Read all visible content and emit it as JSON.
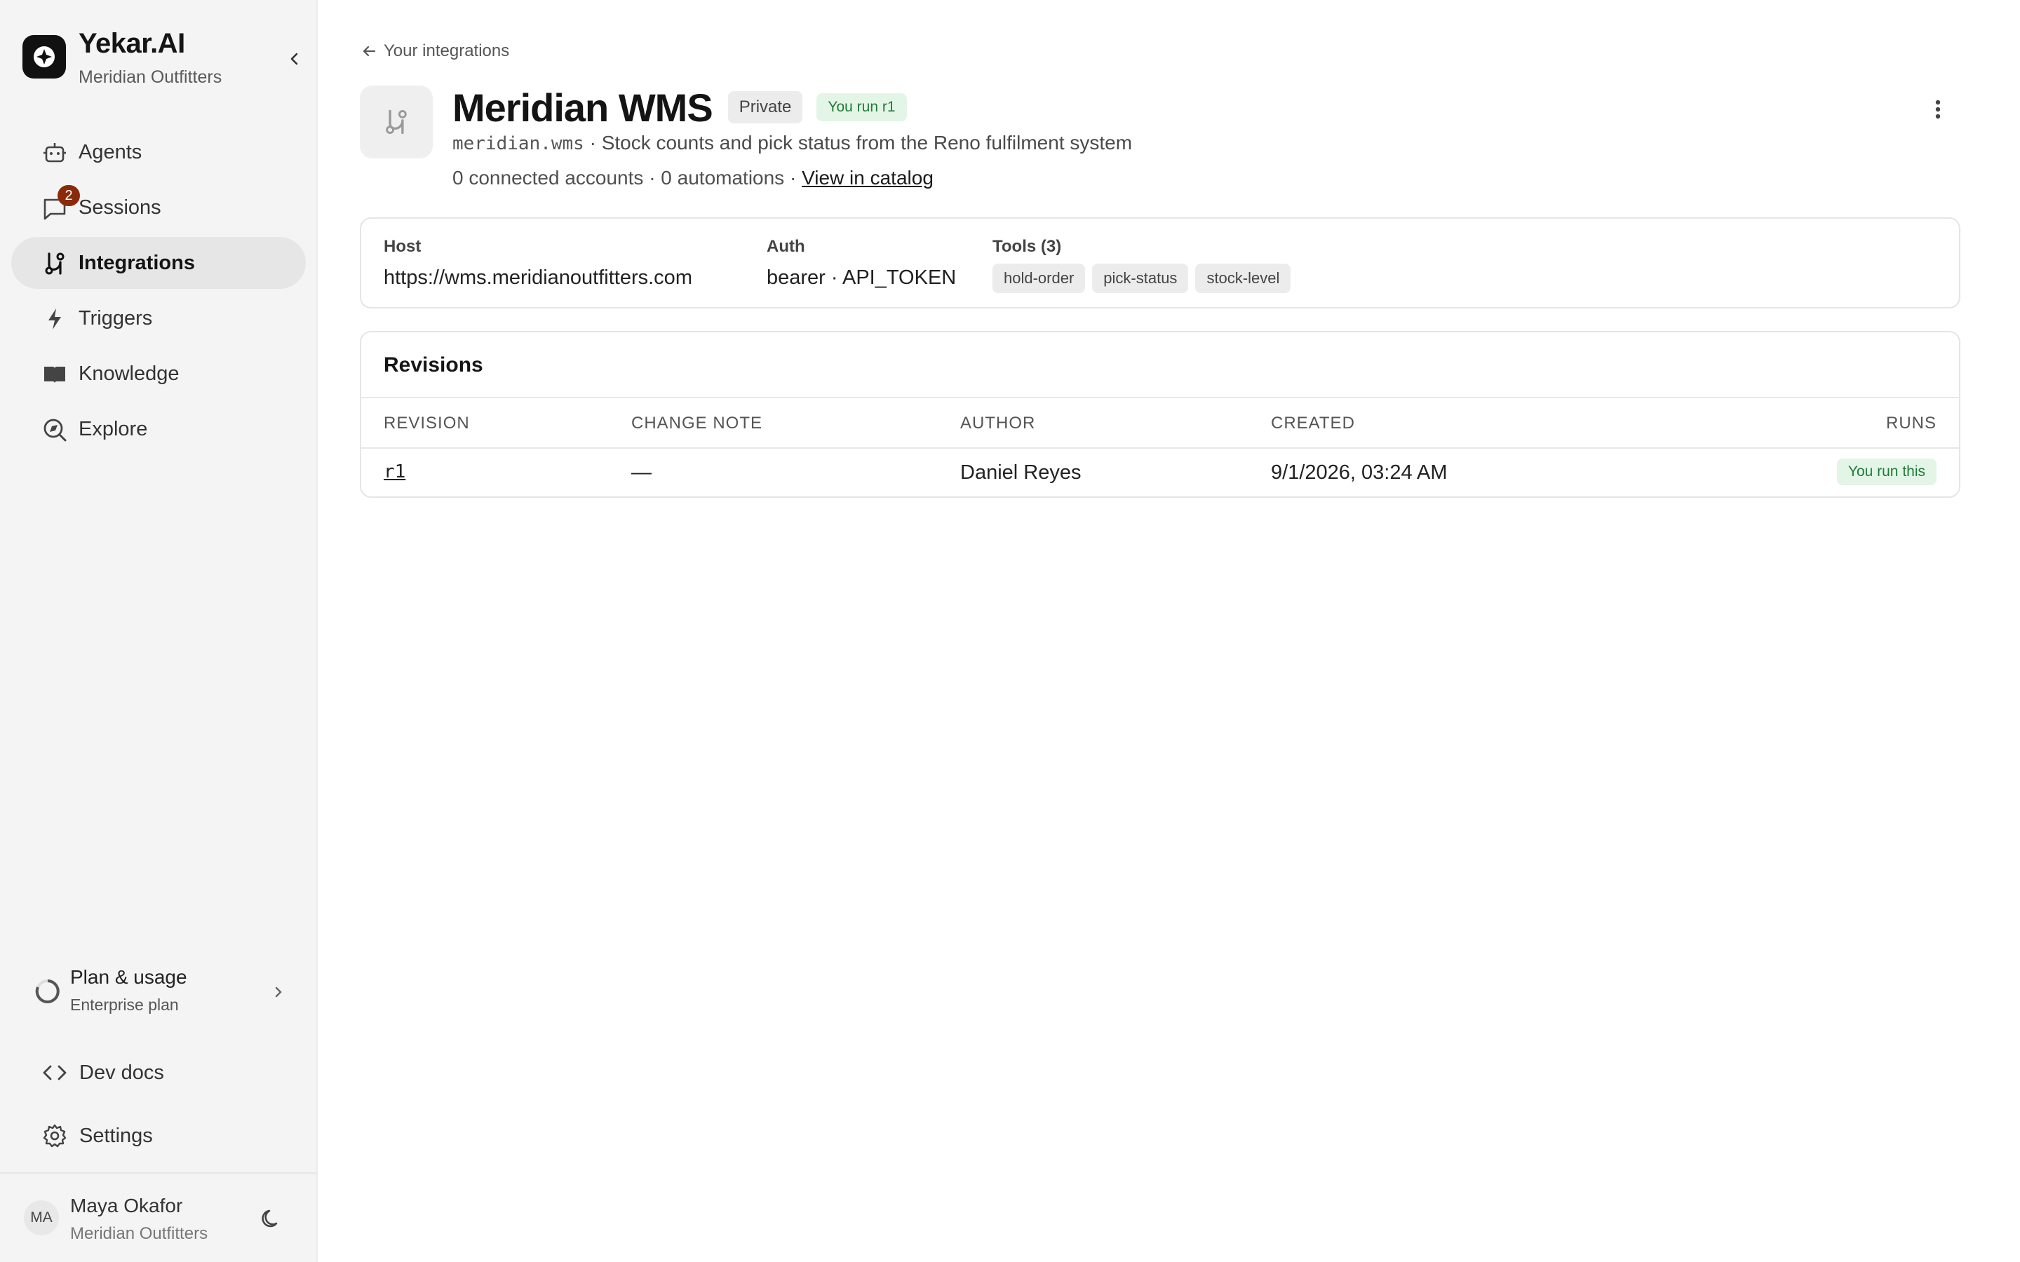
{
  "brand": {
    "name": "Yekar.AI",
    "org": "Meridian Outfitters"
  },
  "nav": {
    "items": [
      {
        "label": "Agents",
        "icon": "robot-icon"
      },
      {
        "label": "Sessions",
        "icon": "chat-icon",
        "badge": "2"
      },
      {
        "label": "Integrations",
        "icon": "plug-icon",
        "active": true
      },
      {
        "label": "Triggers",
        "icon": "bolt-icon"
      },
      {
        "label": "Knowledge",
        "icon": "book-icon"
      },
      {
        "label": "Explore",
        "icon": "explore-icon"
      }
    ]
  },
  "plan": {
    "title": "Plan & usage",
    "subtitle": "Enterprise plan"
  },
  "links": {
    "devdocs": "Dev docs",
    "settings": "Settings"
  },
  "user": {
    "initials": "MA",
    "name": "Maya Okafor",
    "org": "Meridian Outfitters"
  },
  "page": {
    "back": "Your integrations",
    "title": "Meridian WMS",
    "private": "Private",
    "run_pill": "You run r1",
    "slug": "meridian.wms",
    "description": " · Stock counts and pick status from the Reno fulfilment system",
    "meta": "0 connected accounts · 0 automations · ",
    "catalog_link": "View in catalog"
  },
  "info": {
    "host_label": "Host",
    "host_value": "https://wms.meridianoutfitters.com",
    "auth_label": "Auth",
    "auth_value": "bearer · API_TOKEN",
    "tools_label": "Tools (3)",
    "tools": [
      "hold-order",
      "pick-status",
      "stock-level"
    ]
  },
  "revisions": {
    "title": "Revisions",
    "headers": {
      "revision": "REVISION",
      "note": "CHANGE NOTE",
      "author": "AUTHOR",
      "created": "CREATED",
      "runs": "RUNS"
    },
    "rows": [
      {
        "revision": "r1",
        "note": "—",
        "author": "Daniel Reyes",
        "created": "9/1/2026, 03:24 AM",
        "runs": "You run this"
      }
    ]
  },
  "colors": {
    "accent_green": "#217a3a",
    "badge": "#8a2a0b",
    "active_bg": "#e6e6e6"
  }
}
